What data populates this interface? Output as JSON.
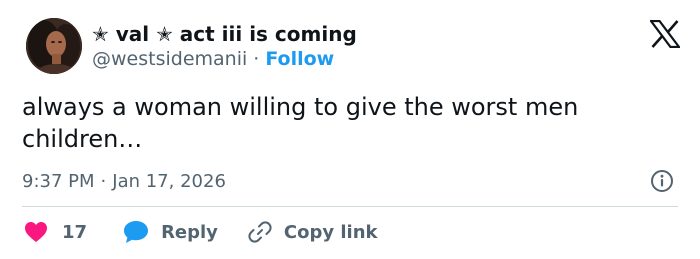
{
  "header": {
    "display_name": "✭ val ✭ act iii is coming",
    "handle": "@westsidemanii",
    "separator": "·",
    "follow_label": "Follow"
  },
  "tweet": {
    "text": "always a woman willing to give the worst men children…"
  },
  "meta": {
    "time": "9:37 PM",
    "separator": "·",
    "date": "Jan 17, 2026"
  },
  "actions": {
    "like_count": "17",
    "reply_label": "Reply",
    "copy_label": "Copy link"
  },
  "icons": {
    "like": "heart-icon",
    "reply": "speech-bubble-icon",
    "copy": "link-icon",
    "info": "info-icon",
    "brand": "x-logo-icon"
  },
  "colors": {
    "text": "#0f1419",
    "muted": "#536471",
    "accent": "#1d9bf0",
    "like": "#f91880",
    "divider": "#cfd9de"
  }
}
